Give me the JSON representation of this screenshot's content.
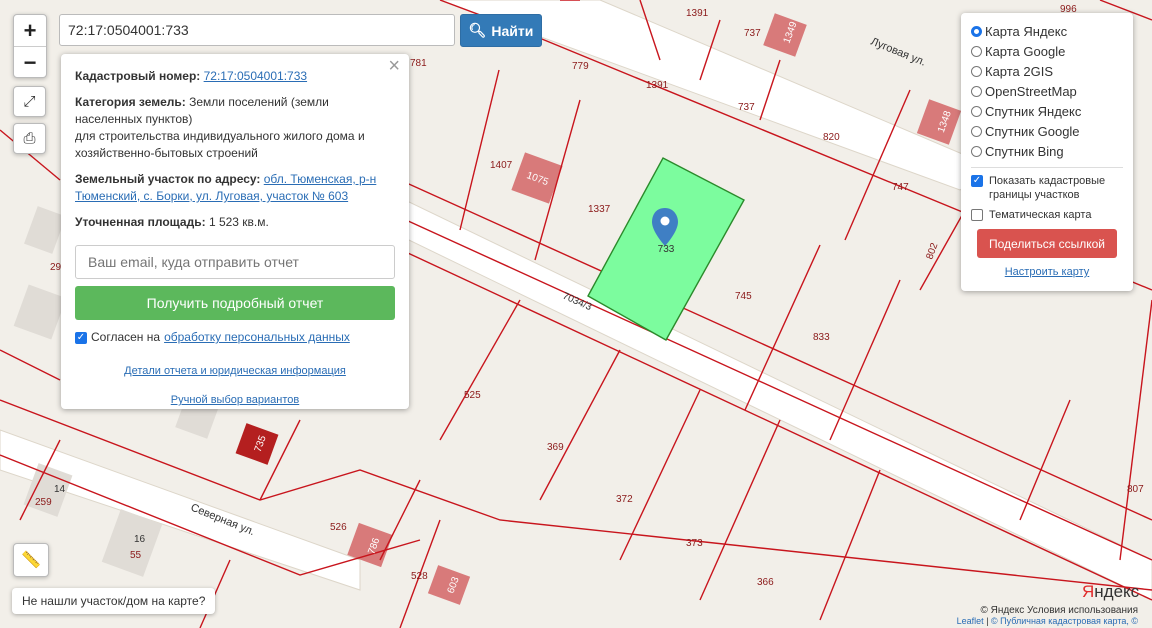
{
  "search": {
    "value": "72:17:0504001:733",
    "button": "Найти"
  },
  "zoom": {
    "in": "+",
    "out": "−"
  },
  "info": {
    "cadastral_label": "Кадастровый номер:",
    "cadastral_value": "72:17:0504001:733",
    "category_label": "Категория земель:",
    "category_value": "Земли поселений (земли населенных пунктов)",
    "purpose": "для строительства индивидуального жилого дома и хозяйственно-бытовых строений",
    "address_label": "Земельный участок по адресу:",
    "address_value": "обл. Тюменская, р-н Тюменский, с. Борки, ул. Луговая, участок № 603",
    "area_label": "Уточненная площадь:",
    "area_value": "1 523 кв.м.",
    "email_placeholder": "Ваш email, куда отправить отчет",
    "report_button": "Получить подробный отчет",
    "agree_text": "Согласен на",
    "agree_link": "обработку персональных данных",
    "details_link": "Детали отчета и юридическая информация",
    "manual_link": "Ручной выбор вариантов"
  },
  "layers": {
    "options": [
      "Карта Яндекс",
      "Карта Google",
      "Карта 2GIS",
      "OpenStreetMap",
      "Спутник Яндекс",
      "Спутник Google",
      "Спутник Bing"
    ],
    "selected": "Карта Яндекс",
    "cadastre": "Показать кадастровые границы участков",
    "thematic": "Тематическая карта",
    "share": "Поделиться ссылкой",
    "setup": "Настроить карту"
  },
  "not_found": "Не нашли участок/дом на карте?",
  "map": {
    "plot_label": "733",
    "street_lugovaya": "Луговая ул.",
    "street_severnaya": "Северная ул.",
    "road": "7034/3",
    "numbers": [
      "1391",
      "1391",
      "737",
      "779",
      "737",
      "820",
      "1407",
      "1075",
      "1337",
      "747",
      "745",
      "802",
      "833",
      "525",
      "369",
      "372",
      "373",
      "366",
      "526",
      "528",
      "807",
      "259",
      "14",
      "16",
      "55",
      "781",
      "1348",
      "1349",
      "996",
      "735",
      "786",
      "603",
      "29"
    ],
    "yandex_logo": "Яндекс",
    "copyright": "© Яндекс  Условия использования",
    "leaflet": "Leaflet",
    "pkk": "© Публичная кадастровая карта, ©"
  },
  "colors": {
    "parcel_line": "#c8151d",
    "selected_fill": "#7cfc9e",
    "primary": "#337ab7",
    "success": "#5cb85c",
    "danger": "#d9534f"
  }
}
